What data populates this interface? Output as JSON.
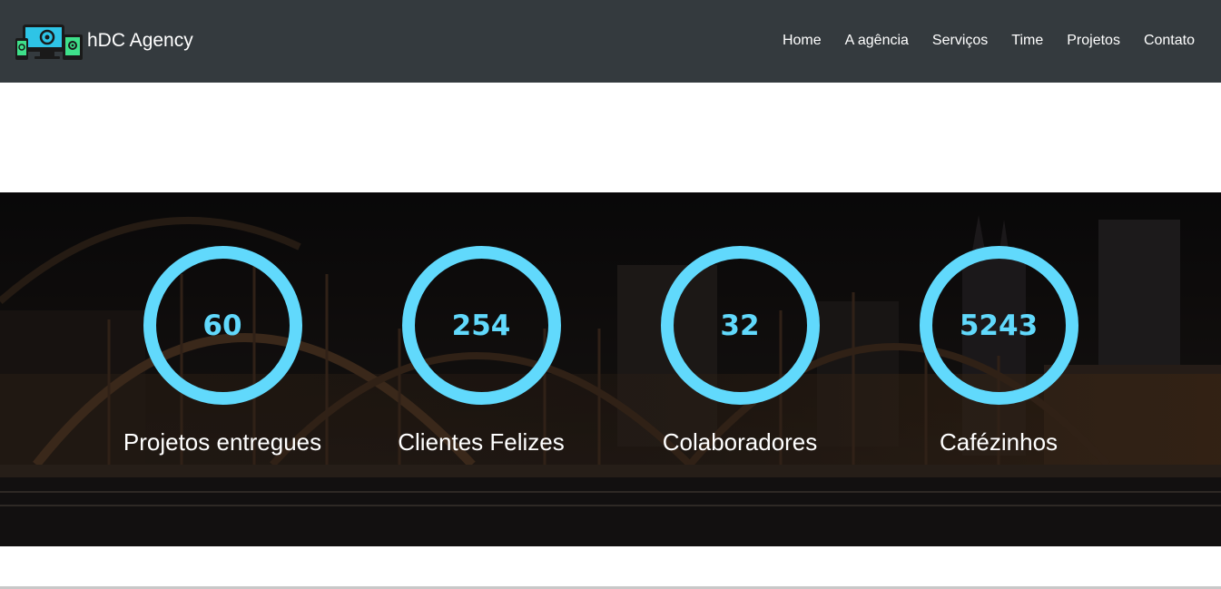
{
  "brand": {
    "name": "hDC Agency",
    "logo_icon": "devices-logo-icon"
  },
  "nav": {
    "items": [
      "Home",
      "A agência",
      "Serviços",
      "Time",
      "Projetos",
      "Contato"
    ]
  },
  "stats": [
    {
      "value": "60",
      "label": "Projetos entregues"
    },
    {
      "value": "254",
      "label": "Clientes Felizes"
    },
    {
      "value": "32",
      "label": "Colaboradores"
    },
    {
      "value": "5243",
      "label": "Cafézinhos"
    }
  ],
  "colors": {
    "navbar": "#343a3e",
    "accent": "#61d9fc",
    "text": "#ffffff"
  }
}
